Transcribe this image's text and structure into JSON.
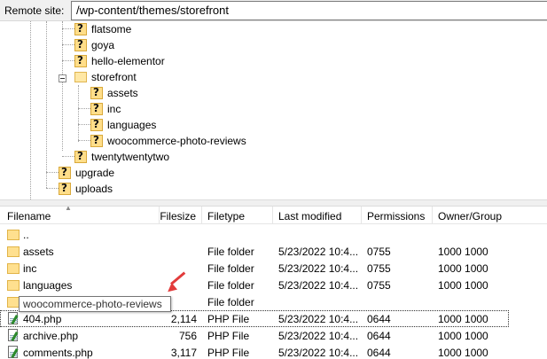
{
  "remote_site": {
    "label": "Remote site:",
    "path": "/wp-content/themes/storefront"
  },
  "tree": {
    "nodes": [
      {
        "label": "flatsome",
        "icon": "question-folder-icon"
      },
      {
        "label": "goya",
        "icon": "question-folder-icon"
      },
      {
        "label": "hello-elementor",
        "icon": "question-folder-icon"
      },
      {
        "label": "storefront",
        "icon": "open-folder-icon",
        "expanded": true
      },
      {
        "label": "assets",
        "icon": "question-folder-icon"
      },
      {
        "label": "inc",
        "icon": "question-folder-icon"
      },
      {
        "label": "languages",
        "icon": "question-folder-icon"
      },
      {
        "label": "woocommerce-photo-reviews",
        "icon": "question-folder-icon"
      },
      {
        "label": "twentytwentytwo",
        "icon": "question-folder-icon"
      },
      {
        "label": "upgrade",
        "icon": "question-folder-icon"
      },
      {
        "label": "uploads",
        "icon": "question-folder-icon"
      }
    ]
  },
  "file_list": {
    "headers": {
      "filename": "Filename",
      "filesize": "Filesize",
      "filetype": "Filetype",
      "last_modified": "Last modified",
      "permissions": "Permissions",
      "owner_group": "Owner/Group"
    },
    "rows": [
      {
        "name": "..",
        "size": "",
        "type": "",
        "modified": "",
        "perms": "",
        "owner": "",
        "icon": "folder-icon"
      },
      {
        "name": "assets",
        "size": "",
        "type": "File folder",
        "modified": "5/23/2022 10:4...",
        "perms": "0755",
        "owner": "1000 1000",
        "icon": "folder-icon"
      },
      {
        "name": "inc",
        "size": "",
        "type": "File folder",
        "modified": "5/23/2022 10:4...",
        "perms": "0755",
        "owner": "1000 1000",
        "icon": "folder-icon"
      },
      {
        "name": "languages",
        "size": "",
        "type": "File folder",
        "modified": "5/23/2022 10:4...",
        "perms": "0755",
        "owner": "1000 1000",
        "icon": "folder-icon"
      },
      {
        "name": "",
        "size": "",
        "type": "File folder",
        "modified": "",
        "perms": "",
        "owner": "",
        "icon": "folder-icon"
      },
      {
        "name": "404.php",
        "size": "2,114",
        "type": "PHP File",
        "modified": "5/23/2022 10:4...",
        "perms": "0644",
        "owner": "1000 1000",
        "icon": "php-file-icon"
      },
      {
        "name": "archive.php",
        "size": "756",
        "type": "PHP File",
        "modified": "5/23/2022 10:4...",
        "perms": "0644",
        "owner": "1000 1000",
        "icon": "php-file-icon"
      },
      {
        "name": "comments.php",
        "size": "3,117",
        "type": "PHP File",
        "modified": "5/23/2022 10:4...",
        "perms": "0644",
        "owner": "1000 1000",
        "icon": "php-file-icon"
      }
    ]
  },
  "tooltip": {
    "text": "woocommerce-photo-reviews"
  },
  "colors": {
    "folder": "#ffe08f",
    "annotation_arrow": "#e23b3b"
  }
}
